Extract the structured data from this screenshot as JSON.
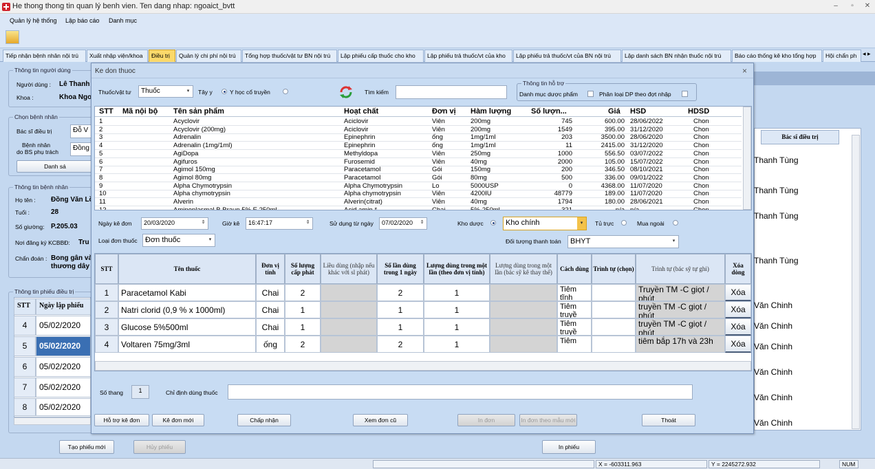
{
  "window": {
    "title": "He thong thong tin quan lý benh vien. Ten dang nhap: ngoaict_bvtt"
  },
  "menu": [
    "Quản lý hệ thống",
    "Lập báo cáo",
    "Danh mục"
  ],
  "tabs": [
    "Tiếp nhận bệnh nhân nội trú",
    "Xuất nhập viện/khoa",
    "Điều trị",
    "Quản lý chi phí nội trú",
    "Tổng hợp thuốc/vật tư BN nội trú",
    "Lập phiếu cấp thuốc cho kho",
    "Lập phiếu trả thuốc/vt của kho",
    "Lập phiếu trả thuốc/vt của BN nội trú",
    "Lập danh sách BN nhận thuốc nội trú",
    "Báo cáo thống kê kho tổng hợp",
    "Hội chẩn ph"
  ],
  "left": {
    "user_group": "Thông tin người dùng",
    "user_label": "Người dùng :",
    "user_value": "Lê Thanh",
    "dept_label": "Khoa :",
    "dept_value": "Khoa Ngo",
    "choose_group": "Chọn bệnh nhân",
    "doctor_label": "Bác sĩ điều trị",
    "doctor_value": "Đỗ V",
    "patient_of_label1": "Bệnh nhân",
    "patient_of_label2": "do BS phụ trách",
    "patient_of_value": "Đồng",
    "list_button": "Danh sá",
    "patient_group": "Thông tin bệnh nhân",
    "name_label": "Họ tên :",
    "name_value": "Đồng Văn Lồ",
    "age_label": "Tuổi :",
    "age_value": "28",
    "bed_label": "Số giường:",
    "bed_value": "P.205.03",
    "reg_label": "Nơi đăng ký KCBBĐ:",
    "reg_value": "Tru",
    "diag_label": "Chẩn đoán :",
    "diag_value1": "Bong gân và",
    "diag_value2": "thương dây",
    "sheet_group": "Thông tin phiếu điều trị",
    "sheet_headers": [
      "STT",
      "Ngày lập phiếu"
    ],
    "sheet_rows": [
      [
        "4",
        "05/02/2020"
      ],
      [
        "5",
        "05/02/2020"
      ],
      [
        "6",
        "05/02/2020"
      ],
      [
        "7",
        "05/02/2020"
      ],
      [
        "8",
        "05/02/2020"
      ]
    ],
    "new_sheet": "Tạo phiếu mới",
    "cancel_sheet": "Hủy phiếu"
  },
  "right": {
    "header": "Bác sĩ điều trị",
    "rows": [
      "Thanh Tùng",
      "Thanh Tùng",
      "Thanh Tùng",
      "Thanh Tùng",
      "Văn Chinh",
      "Văn Chinh",
      "Văn Chinh",
      "Văn Chinh",
      "Văn Chinh",
      "Văn Chinh"
    ],
    "print_sheet": "In phiếu"
  },
  "dialog": {
    "title": "Ke don thuoc",
    "close": "×",
    "type_label": "Thuốc/vật tư",
    "type_value": "Thuốc",
    "tayy": "Tây y",
    "yhct": "Y học cổ truyền",
    "search_label": "Tìm kiếm",
    "search_value": "",
    "support_group": "Thông tin hỗ trợ",
    "support_cat": "Danh mục dược phẩm",
    "support_dp": "Phân loại DP theo đợt nhập",
    "product_headers": [
      "STT",
      "Mã nội bộ",
      "Tên sản phẩm",
      "Hoạt chất",
      "Đơn vị",
      "Hàm lượng",
      "Số lượn...",
      "Giá",
      "HSD",
      "HDSD"
    ],
    "products": [
      [
        "1",
        "",
        "Acyclovir",
        "Aciclovir",
        "Viên",
        "200mg",
        "745",
        "600.00",
        "28/06/2022",
        "Chon"
      ],
      [
        "2",
        "",
        "Acyclovir (200mg)",
        "Aciclovir",
        "Viên",
        "200mg",
        "1549",
        "395.00",
        "31/12/2020",
        "Chon"
      ],
      [
        "3",
        "",
        "Adrenalin",
        "Epinephrin",
        "ống",
        "1mg/1ml",
        "203",
        "3500.00",
        "28/06/2020",
        "Chon"
      ],
      [
        "4",
        "",
        "Adrenalin (1mg/1ml)",
        "Epinephrin",
        "ống",
        "1mg/1ml",
        "11",
        "2415.00",
        "31/12/2020",
        "Chon"
      ],
      [
        "5",
        "",
        "AgiDopa",
        "Methyldopa",
        "Viên",
        "250mg",
        "1000",
        "556.50",
        "03/07/2022",
        "Chon"
      ],
      [
        "6",
        "",
        "Agifuros",
        "Furosemid",
        "Viên",
        "40mg",
        "2000",
        "105.00",
        "15/07/2022",
        "Chon"
      ],
      [
        "7",
        "",
        "Agimol 150mg",
        "Paracetamol",
        "Gói",
        "150mg",
        "200",
        "346.50",
        "08/10/2021",
        "Chon"
      ],
      [
        "8",
        "",
        "Agimol 80mg",
        "Paracetamol",
        "Gói",
        "80mg",
        "500",
        "336.00",
        "09/01/2022",
        "Chon"
      ],
      [
        "9",
        "",
        "Alpha Chymotrypsin",
        "Alpha Chymotrypsin",
        "Lo",
        "5000USP",
        "0",
        "4368.00",
        "11/07/2020",
        "Chon"
      ],
      [
        "10",
        "",
        "Alpha chymotrypsin",
        "Alpha chymotrypsin",
        "Viên",
        "4200IU",
        "48779",
        "189.00",
        "11/07/2020",
        "Chon"
      ],
      [
        "11",
        "",
        "Alverin",
        "Alverin(citrat)",
        "Viên",
        "40mg",
        "1794",
        "180.00",
        "28/06/2021",
        "Chon"
      ],
      [
        "12",
        "",
        "Aminoplasmal B.Braun 5% E 250ml",
        "Acid amin.*",
        "Chai",
        "5%-250ml",
        "321",
        "n/a",
        "n/a",
        "Chon"
      ]
    ],
    "date_label": "Ngày kê đơn",
    "date_value": "20/03/2020",
    "time_label": "Giờ kê",
    "time_value": "16:47:17",
    "use_from_label": "Sử dụng từ ngày",
    "use_from_value": "07/02/2020",
    "store_label": "Kho dược",
    "store_value": "Kho chính",
    "tutruc": "Tủ trực",
    "muangoai": "Mua ngoài",
    "rx_type_label": "Loại đơn thuốc",
    "rx_type_value": "Đơn thuốc",
    "payer_label": "Đối tượng thanh toán",
    "payer_value": "BHYT",
    "grid_headers": [
      "STT",
      "Tên thuốc",
      "Đơn vị tính",
      "Số lượng cấp phát",
      "Liều dùng (nhập nếu khác với sl phát)",
      "Số lần dùng trong 1 ngày",
      "Lượng dùng trong một lần (theo đơn vị tính)",
      "Lượng dùng trong một lần (bác sỹ kê thay thế)",
      "Cách dùng",
      "Trình tự (chọn)",
      "Trình tự (bác sỹ tự ghi)",
      "Xóa dòng"
    ],
    "grid_rows": [
      [
        "1",
        "Paracetamol Kabi",
        "Chai",
        "2",
        "",
        "2",
        "1",
        "",
        "Tiêm tĩnh",
        "",
        "Truyền TM -C giọt / phút",
        "Xóa"
      ],
      [
        "2",
        "Natri clorid (0,9 % x 1000ml)",
        "Chai",
        "1",
        "",
        "1",
        "1",
        "",
        "Tiêm truyề",
        "",
        "truyền TM -C giọt / phút",
        "Xóa"
      ],
      [
        "3",
        "Glucose 5%500ml",
        "Chai",
        "1",
        "",
        "1",
        "1",
        "",
        "Tiêm truyề",
        "",
        "truyền TM -C giọt / phút",
        "Xóa"
      ],
      [
        "4",
        "Voltaren 75mg/3ml",
        "ống",
        "2",
        "",
        "2",
        "1",
        "",
        "Tiêm",
        "",
        "tiêm bắp 17h và 23h",
        "Xóa"
      ]
    ],
    "doses_label": "Số thang",
    "doses_value": "1",
    "instr_label": "Chỉ định dùng thuốc",
    "instr_value": "",
    "buttons": {
      "support": "Hỗ trợ kê đơn",
      "new": "Kê đơn mới",
      "accept": "Chấp nhận",
      "view_old": "Xem đơn cũ",
      "print": "In đơn",
      "print_tpl": "In đơn theo mẫu mới",
      "exit": "Thoát"
    }
  },
  "status": {
    "x": "X = -603311.963",
    "y": "Y = 2245272.932",
    "num": "NUM"
  },
  "colors": {
    "active_tab": "#fbd96a",
    "panel": "#c4d8f0",
    "selected_row": "#3a6fb3"
  }
}
